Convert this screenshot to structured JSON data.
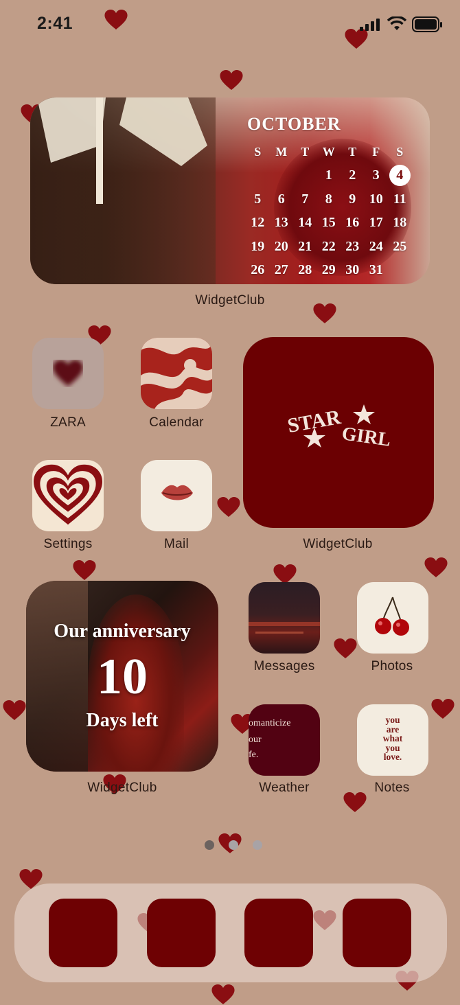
{
  "status_bar": {
    "time": "2:41"
  },
  "calendar_widget": {
    "month": "OCTOBER",
    "weekdays": [
      "S",
      "M",
      "T",
      "W",
      "T",
      "F",
      "S"
    ],
    "leading_blanks": 3,
    "days": [
      "1",
      "2",
      "3",
      "4",
      "5",
      "6",
      "7",
      "8",
      "9",
      "10",
      "11",
      "12",
      "13",
      "14",
      "15",
      "16",
      "17",
      "18",
      "19",
      "20",
      "21",
      "22",
      "23",
      "24",
      "25",
      "26",
      "27",
      "28",
      "29",
      "30",
      "31"
    ],
    "today": "4",
    "label": "WidgetClub"
  },
  "apps": {
    "zara": "ZARA",
    "calendar": "Calendar",
    "settings": "Settings",
    "mail": "Mail",
    "messages": "Messages",
    "photos": "Photos",
    "weather": "Weather",
    "notes": "Notes"
  },
  "star_girl_widget": {
    "text_line1": "STAR",
    "text_line2": "GIRL",
    "label": "WidgetClub"
  },
  "anniversary_widget": {
    "title": "Our anniversary",
    "count": "10",
    "suffix": "Days left",
    "label": "WidgetClub"
  },
  "weather_icon": {
    "lines": [
      "omanticize",
      "our",
      "fe."
    ]
  },
  "notes_icon": {
    "lines": [
      "you",
      "are",
      "what",
      "you",
      "love."
    ]
  },
  "page_indicator": {
    "pages": 3,
    "current": 1
  },
  "colors": {
    "background": "#c09d88",
    "accent": "#6e0103",
    "heart": "#8a0e12"
  }
}
